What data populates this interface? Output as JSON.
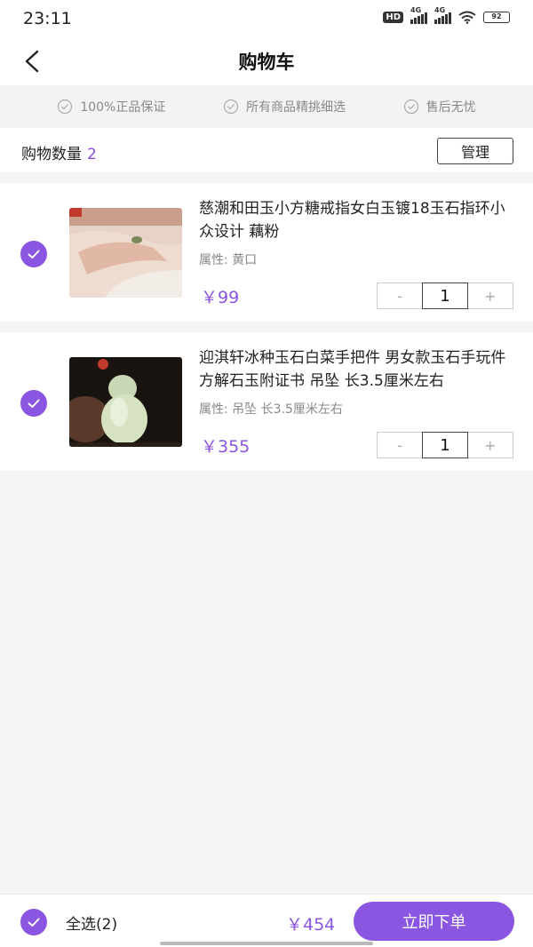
{
  "status_bar": {
    "time": "23:11",
    "network_a": "4G",
    "network_b": "4G",
    "battery": "92",
    "hd_label": "HD"
  },
  "header": {
    "title": "购物车",
    "back_icon": "back-arrow-icon"
  },
  "guarantees": [
    {
      "label": "100%正品保证"
    },
    {
      "label": "所有商品精挑细选"
    },
    {
      "label": "售后无忧"
    }
  ],
  "cart": {
    "count_label": "购物数量",
    "count": "2",
    "manage_label": "管理"
  },
  "items": [
    {
      "name": "慈潮和田玉小方糖戒指女白玉镀18玉石指环小众设计 藕粉",
      "attr": "属性: 黄口",
      "price": "￥99",
      "quantity": "1",
      "minus": "-",
      "plus": "+",
      "checked": true
    },
    {
      "name": "迎淇轩冰种玉石白菜手把件 男女款玉石手玩件方解石玉附证书 吊坠 长3.5厘米左右",
      "attr": "属性: 吊坠 长3.5厘米左右",
      "price": "￥355",
      "quantity": "1",
      "minus": "-",
      "plus": "+",
      "checked": true
    }
  ],
  "footer": {
    "select_all_label": "全选(2)",
    "total": "￥454",
    "order_button": "立即下单"
  },
  "colors": {
    "accent": "#8a55e0",
    "background": "#f5f5f5"
  }
}
